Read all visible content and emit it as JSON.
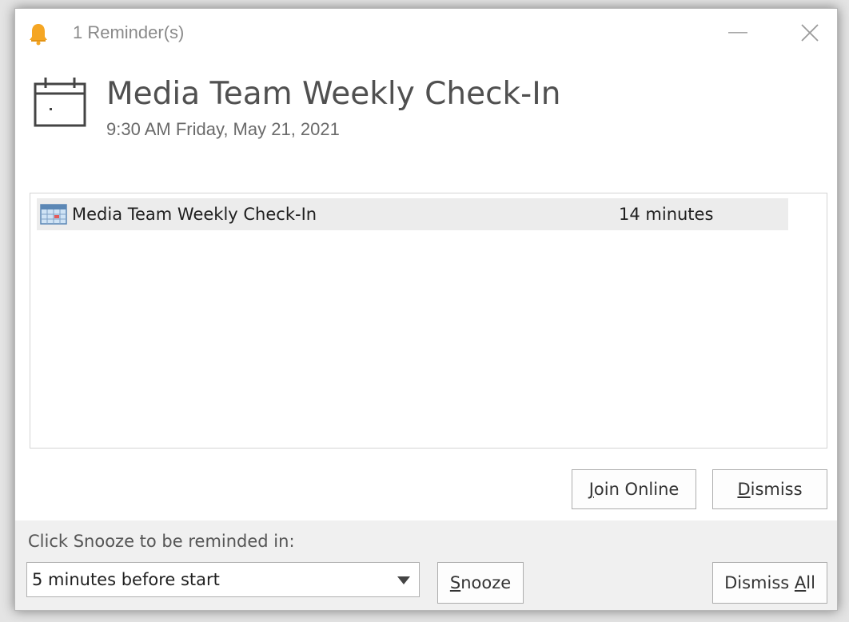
{
  "window": {
    "title": "1 Reminder(s)",
    "minimize_icon": "minimize-icon",
    "close_icon": "close-icon"
  },
  "header": {
    "subject": "Media Team Weekly Check-In",
    "time": "9:30 AM Friday, May 21, 2021"
  },
  "reminders": [
    {
      "subject": "Media Team Weekly Check-In",
      "due_in": "14 minutes",
      "icon": "appointment-icon"
    }
  ],
  "buttons": {
    "join_online": {
      "accel": "J",
      "rest": "oin Online"
    },
    "dismiss": {
      "accel": "D",
      "rest": "ismiss"
    },
    "snooze": {
      "accel": "S",
      "rest": "nooze"
    },
    "dismiss_all": {
      "before": "Dismiss ",
      "accel": "A",
      "rest": "ll"
    }
  },
  "snooze": {
    "label": "Click Snooze to be reminded in:",
    "selected": "5 minutes before start"
  },
  "colors": {
    "bell": "#f5a623",
    "selected_row": "#ececec",
    "bottom_panel": "#f0f0f0"
  }
}
